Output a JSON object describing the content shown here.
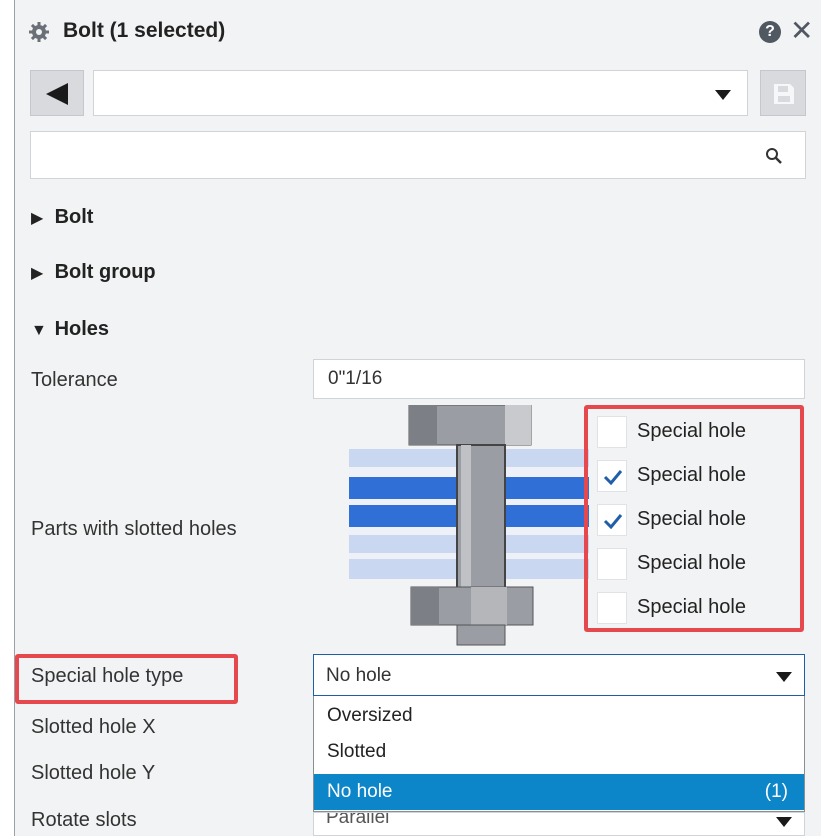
{
  "header": {
    "title": "Bolt (1 selected)",
    "help": "?",
    "close": "✕"
  },
  "toolbar": {
    "preset_value": ""
  },
  "search": {
    "placeholder": ""
  },
  "sections": {
    "bolt": "Bolt",
    "bolt_group": "Bolt group",
    "holes": "Holes"
  },
  "holes": {
    "tolerance_label": "Tolerance",
    "tolerance_value": "0\"1/16",
    "slotted_parts_label": "Parts with slotted holes",
    "checkboxes": [
      {
        "label": "Special hole",
        "checked": false
      },
      {
        "label": "Special hole",
        "checked": true
      },
      {
        "label": "Special hole",
        "checked": true
      },
      {
        "label": "Special hole",
        "checked": false
      },
      {
        "label": "Special hole",
        "checked": false
      }
    ],
    "special_type_label": "Special hole type",
    "special_type_value": "No hole",
    "options": [
      "Oversized",
      "Slotted",
      "No hole"
    ],
    "selected_count": "(1)",
    "slotted_x_label": "Slotted hole X",
    "slotted_y_label": "Slotted hole Y",
    "rotate_label": "Rotate slots",
    "rotate_value": "Parallel"
  },
  "colors": {
    "highlight": "#e5484d",
    "selection": "#0c86c9",
    "plate_blue": "#2f6fd6",
    "plate_light": "#c9d8f0"
  }
}
